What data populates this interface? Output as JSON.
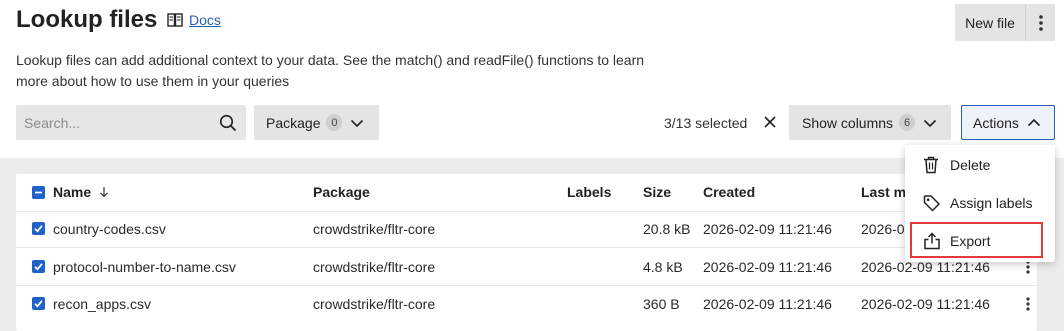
{
  "page": {
    "title": "Lookup files",
    "docs_label": "Docs",
    "description": "Lookup files can add additional context to your data. See the match() and readFile() functions to learn more about how to use them in your queries",
    "new_file_label": "New file"
  },
  "toolbar": {
    "search_placeholder": "Search...",
    "package_label": "Package",
    "package_count": "0",
    "selected_text": "3/13 selected",
    "show_columns_label": "Show columns",
    "show_columns_count": "6",
    "actions_label": "Actions"
  },
  "table": {
    "columns": [
      "Name",
      "Package",
      "Labels",
      "Size",
      "Created",
      "Last m"
    ],
    "rows": [
      {
        "name": "country-codes.csv",
        "package": "crowdstrike/fltr-core",
        "labels": "",
        "size": "20.8 kB",
        "created": "2026-02-09 11:21:46",
        "last_modified": "2026-0"
      },
      {
        "name": "protocol-number-to-name.csv",
        "package": "crowdstrike/fltr-core",
        "labels": "",
        "size": "4.8 kB",
        "created": "2026-02-09 11:21:46",
        "last_modified": "2026-02-09 11:21:46"
      },
      {
        "name": "recon_apps.csv",
        "package": "crowdstrike/fltr-core",
        "labels": "",
        "size": "360 B",
        "created": "2026-02-09 11:21:46",
        "last_modified": "2026-02-09 11:21:46"
      }
    ]
  },
  "actions_menu": {
    "items": [
      {
        "label": "Delete",
        "icon": "trash-icon"
      },
      {
        "label": "Assign labels",
        "icon": "tag-icon"
      },
      {
        "label": "Export",
        "icon": "export-icon"
      }
    ]
  },
  "colors": {
    "accent": "#1f63c9",
    "link": "#2a5db0",
    "highlight": "#e23b3b"
  }
}
